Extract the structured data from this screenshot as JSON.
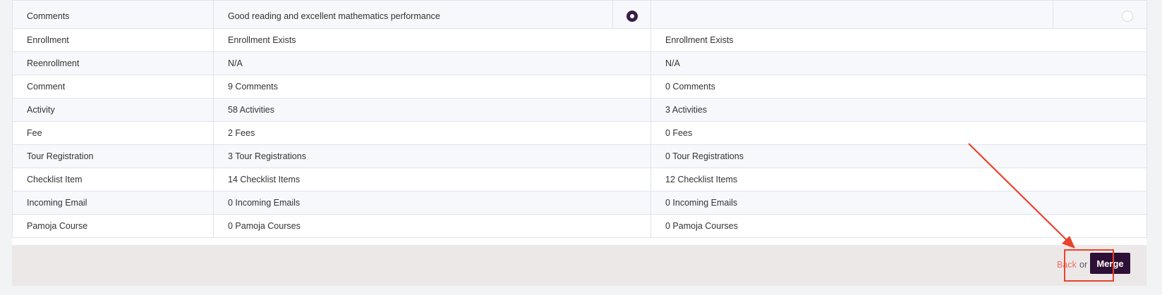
{
  "merge_table": {
    "rows": [
      {
        "label": "Comments",
        "left": "Good reading and excellent mathematics performance",
        "right": ""
      },
      {
        "label": "Enrollment",
        "left": "Enrollment Exists",
        "right": "Enrollment Exists"
      },
      {
        "label": "Reenrollment",
        "left": "N/A",
        "right": "N/A"
      },
      {
        "label": "Comment",
        "left": "9 Comments",
        "right": "0 Comments"
      },
      {
        "label": "Activity",
        "left": "58 Activities",
        "right": "3 Activities"
      },
      {
        "label": "Fee",
        "left": "2 Fees",
        "right": "0 Fees"
      },
      {
        "label": "Tour Registration",
        "left": "3 Tour Registrations",
        "right": "0 Tour Registrations"
      },
      {
        "label": "Checklist Item",
        "left": "14 Checklist Items",
        "right": "12 Checklist Items"
      },
      {
        "label": "Incoming Email",
        "left": "0 Incoming Emails",
        "right": "0 Incoming Emails"
      },
      {
        "label": "Pamoja Course",
        "left": "0 Pamoja Courses",
        "right": "0 Pamoja Courses"
      }
    ],
    "comments_selected": "left"
  },
  "footer": {
    "back_label": "Back",
    "or_label": "or",
    "merge_label": "Merge"
  },
  "colors": {
    "accent": "#2e0f35",
    "link": "#e8735f",
    "annotation": "#e8432b"
  }
}
